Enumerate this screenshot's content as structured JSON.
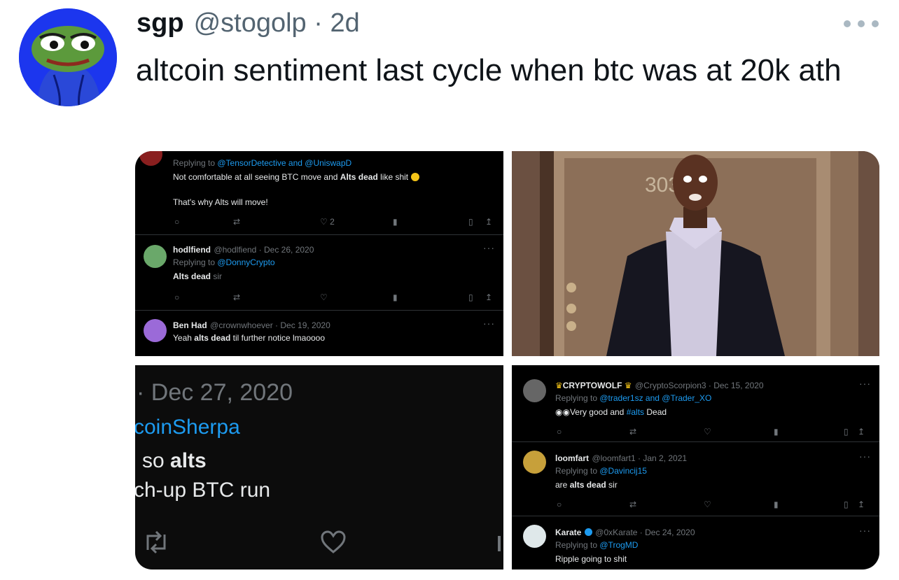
{
  "tweet": {
    "display_name": "sgp",
    "handle_time": "@stogolp · 2d",
    "text": "altcoin sentiment last cycle when btc was at 20k ath",
    "avatar_icon": "pepe-frog-avatar-icon",
    "more_icon": "more-options-icon"
  },
  "panel1": {
    "reply_to_prefix": "Replying to ",
    "reply_to_users": "@TensorDetective and @UniswapD",
    "line1_plain": "Not comfortable at all seeing BTC move and ",
    "line1_bold": "Alts dead",
    "line1_end": " like shit",
    "line2": "That's why Alts will move!",
    "likes": "2",
    "t2_name": "hodlfiend",
    "t2_meta": "@hodlfiend · Dec 26, 2020",
    "t2_reply_prefix": "Replying to ",
    "t2_reply_user": "@DonnyCrypto",
    "t2_text_bold": "Alts dead",
    "t2_text_end": " sir",
    "t3_name": "Ben Had",
    "t3_meta": "@crownwhoever · Dec 19, 2020",
    "t3_text_start": "Yeah ",
    "t3_text_bold": "alts dead",
    "t3_text_end": " til further notice lmaoooo"
  },
  "panel3": {
    "date": "· Dec 27, 2020",
    "author": "coinSherpa",
    "text_start": "so ",
    "text_bold": "alts",
    "text_line2": "ch-up BTC run"
  },
  "panel4": {
    "t1_name": "CRYPTOWOLF",
    "t1_meta": "@CryptoScorpion3 · Dec 15, 2020",
    "t1_reply_prefix": "Replying to ",
    "t1_reply_users": "@trader1sz and @Trader_XO",
    "t1_text_start": "Very good and ",
    "t1_text_tag": "#alts",
    "t1_text_end": " Dead",
    "t2_name": "loomfart",
    "t2_meta": "@loomfart1 · Jan 2, 2021",
    "t2_reply_prefix": "Replying to ",
    "t2_reply_user": "@Davincij15",
    "t2_text_start": "are ",
    "t2_text_bold": "alts dead",
    "t2_text_end": " sir",
    "t3_name": "Karate",
    "t3_meta": "@0xKarate · Dec 24, 2020",
    "t3_reply_prefix": "Replying to ",
    "t3_reply_user": "@TrogMD",
    "t3_text": "Ripple going to shit"
  },
  "panel2": {
    "door_number": "303",
    "image_icon": "shocked-man-gif-icon"
  },
  "colors": {
    "link_blue": "#1d9bf0",
    "dark_bg": "#000000",
    "secondary_text": "#536471"
  }
}
